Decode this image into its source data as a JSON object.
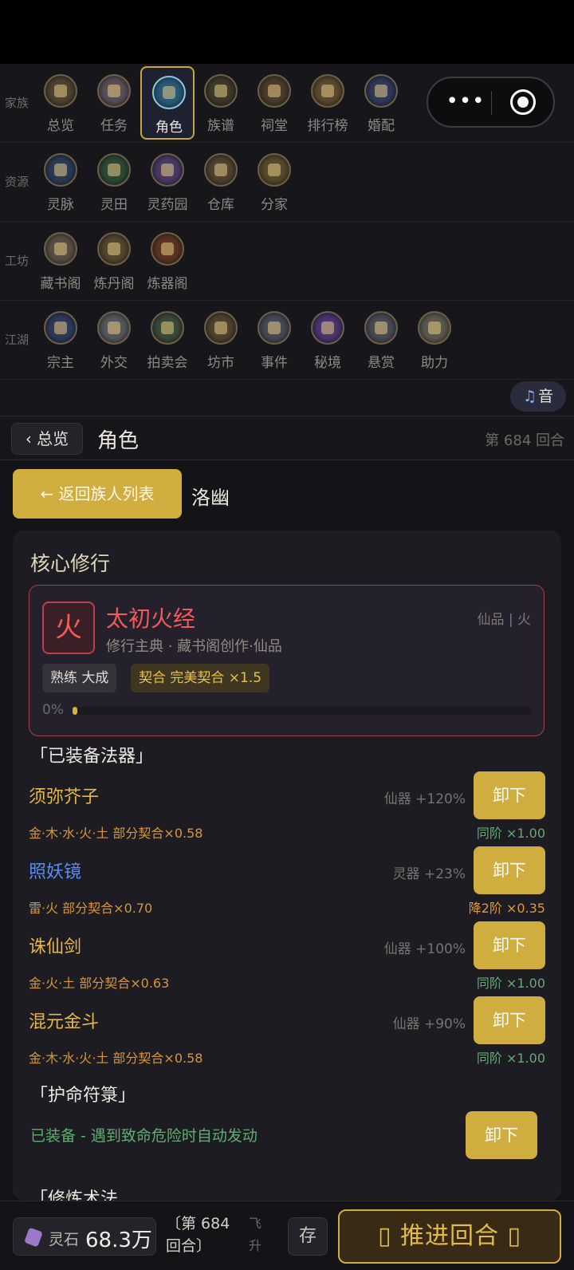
{
  "nav": {
    "rows": [
      {
        "label": "家族",
        "items": [
          "总览",
          "任务",
          "角色",
          "族谱",
          "祠堂",
          "排行榜",
          "婚配"
        ]
      },
      {
        "label": "资源",
        "items": [
          "灵脉",
          "灵田",
          "灵药园",
          "仓库",
          "分家"
        ]
      },
      {
        "label": "工坊",
        "items": [
          "藏书阁",
          "炼丹阁",
          "炼器阁"
        ]
      },
      {
        "label": "江湖",
        "items": [
          "宗主",
          "外交",
          "拍卖会",
          "坊市",
          "事件",
          "秘境",
          "悬赏",
          "助力"
        ]
      }
    ],
    "active": "角色",
    "music_label": "音"
  },
  "header": {
    "back_label": "总览",
    "title": "角色",
    "turn": "第 684 回合"
  },
  "character": {
    "return_label": "← 返回族人列表",
    "name": "洛幽"
  },
  "core": {
    "title": "核心修行",
    "manual": {
      "element_char": "火",
      "name": "太初火经",
      "grade": "仙品 | 火",
      "desc": "修行主典 · 藏书阁创作·仙品",
      "proficiency_tag": "熟练 大成",
      "fit_tag": "契合 完美契合 ×1.5",
      "progress_label": "0%",
      "progress_value": 0.01
    }
  },
  "artifacts": {
    "title": "「已装备法器」",
    "unequip_label": "卸下",
    "items": [
      {
        "name": "须弥芥子",
        "bonus": "仙器 +120%",
        "fit": "金·木·水·火·土 部分契合×0.58",
        "mult": "同阶 ×1.00",
        "name_color": "#e5b84a",
        "mult_color": "#5fae70"
      },
      {
        "name": "照妖镜",
        "bonus": "灵器 +23%",
        "fit": "雷·火 部分契合×0.70",
        "mult": "降2阶 ×0.35",
        "name_color": "#5b8df0",
        "mult_color": "#e0993a"
      },
      {
        "name": "诛仙剑",
        "bonus": "仙器 +100%",
        "fit": "金·火·土 部分契合×0.63",
        "mult": "同阶 ×1.00",
        "name_color": "#e5b84a",
        "mult_color": "#5fae70"
      },
      {
        "name": "混元金斗",
        "bonus": "仙器 +90%",
        "fit": "金·木·水·火·土 部分契合×0.58",
        "mult": "同阶 ×1.00",
        "name_color": "#e5b84a",
        "mult_color": "#5fae70"
      }
    ]
  },
  "talisman": {
    "title": "「护命符箓」",
    "status": "已装备 - 遇到致命危险时自动发动",
    "button": "卸下"
  },
  "next_section_partial": "「修炼术法",
  "bottom": {
    "stone_label": "灵石",
    "stone_value": "68.3万",
    "turn_info": "〔第 684 回合〕",
    "ascend": "飞升",
    "save": "存",
    "advance": "推进回合"
  }
}
